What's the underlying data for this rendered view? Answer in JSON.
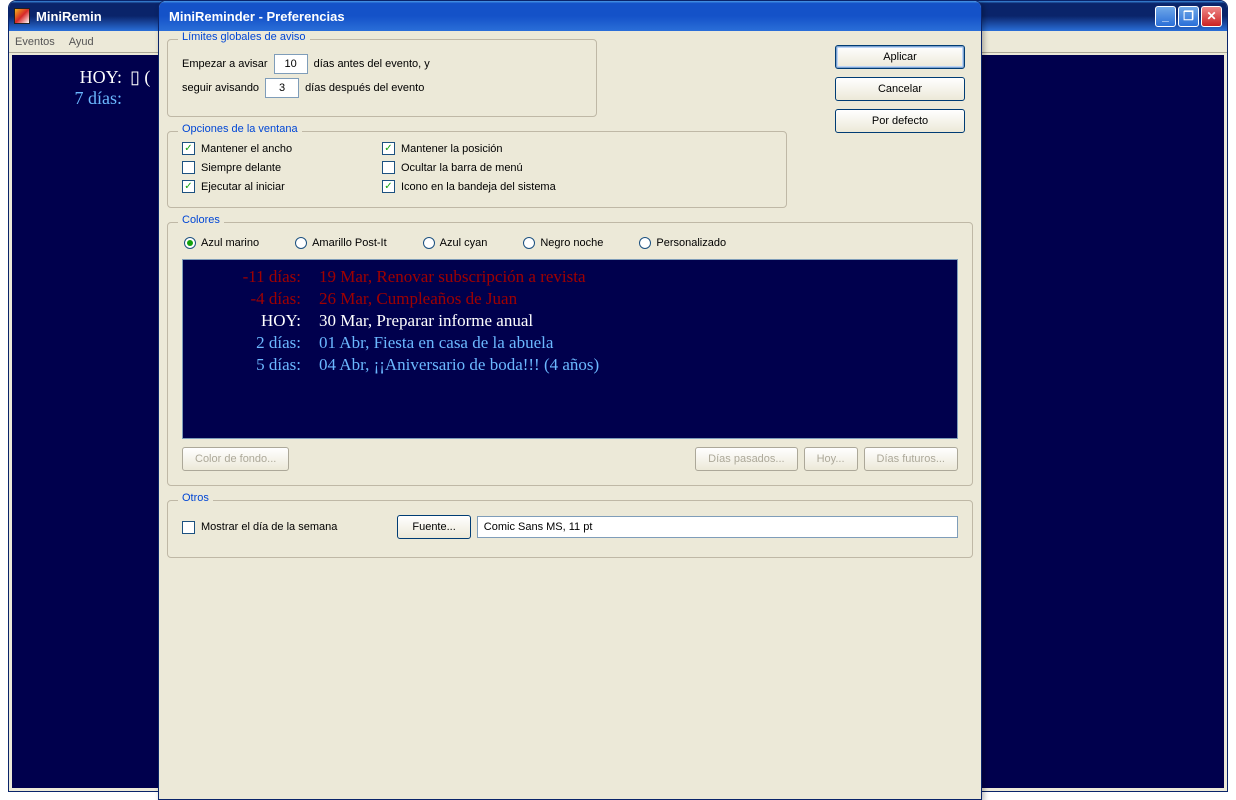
{
  "main": {
    "title": "MiniRemin",
    "menu": {
      "events": "Eventos",
      "help": "Ayud"
    },
    "bg_rows": [
      {
        "label": "HOY:",
        "text": "▯ ("
      },
      {
        "label": "7 días:",
        "text": ""
      }
    ]
  },
  "win_btns": {
    "min": "_",
    "max": "❐",
    "close": "✕"
  },
  "dialog": {
    "title": "MiniReminder - Preferencias"
  },
  "buttons": {
    "apply": "Aplicar",
    "cancel": "Cancelar",
    "default": "Por defecto"
  },
  "limits": {
    "legend": "Límites globales de aviso",
    "before_label": "Empezar a avisar",
    "before_value": "10",
    "before_suffix": "días antes del evento, y",
    "after_label": "seguir avisando",
    "after_value": "3",
    "after_suffix": "días después del evento"
  },
  "winopts": {
    "legend": "Opciones de la ventana",
    "keep_width": {
      "label": "Mantener el ancho",
      "checked": true
    },
    "keep_pos": {
      "label": "Mantener la posición",
      "checked": true
    },
    "always_top": {
      "label": "Siempre delante",
      "checked": false
    },
    "hide_menu": {
      "label": "Ocultar la barra de menú",
      "checked": false
    },
    "run_start": {
      "label": "Ejecutar al iniciar",
      "checked": true
    },
    "tray_icon": {
      "label": "Icono en la bandeja del sistema",
      "checked": true
    }
  },
  "colors": {
    "legend": "Colores",
    "options": [
      {
        "label": "Azul marino",
        "selected": true
      },
      {
        "label": "Amarillo Post-It",
        "selected": false
      },
      {
        "label": "Azul cyan",
        "selected": false
      },
      {
        "label": "Negro noche",
        "selected": false
      },
      {
        "label": "Personalizado",
        "selected": false
      }
    ],
    "preview": [
      {
        "cls": "c-past",
        "label": "-11 días:",
        "text": "19 Mar, Renovar subscripción a revista"
      },
      {
        "cls": "c-past",
        "label": "-4 días:",
        "text": "26 Mar, Cumpleaños de Juan"
      },
      {
        "cls": "c-today",
        "label": "HOY:",
        "text": "30 Mar, Preparar informe anual"
      },
      {
        "cls": "c-future",
        "label": "2 días:",
        "text": "01 Abr, Fiesta en casa de la abuela"
      },
      {
        "cls": "c-future",
        "label": "5 días:",
        "text": "04 Abr, ¡¡Aniversario de boda!!!  (4 años)"
      }
    ],
    "btns": {
      "bg": "Color de fondo...",
      "past": "Días pasados...",
      "today": "Hoy...",
      "future": "Días futuros..."
    }
  },
  "other": {
    "legend": "Otros",
    "show_weekday": {
      "label": "Mostrar el día de la semana",
      "checked": false
    },
    "font_btn": "Fuente...",
    "font_value": "Comic Sans MS, 11 pt"
  }
}
